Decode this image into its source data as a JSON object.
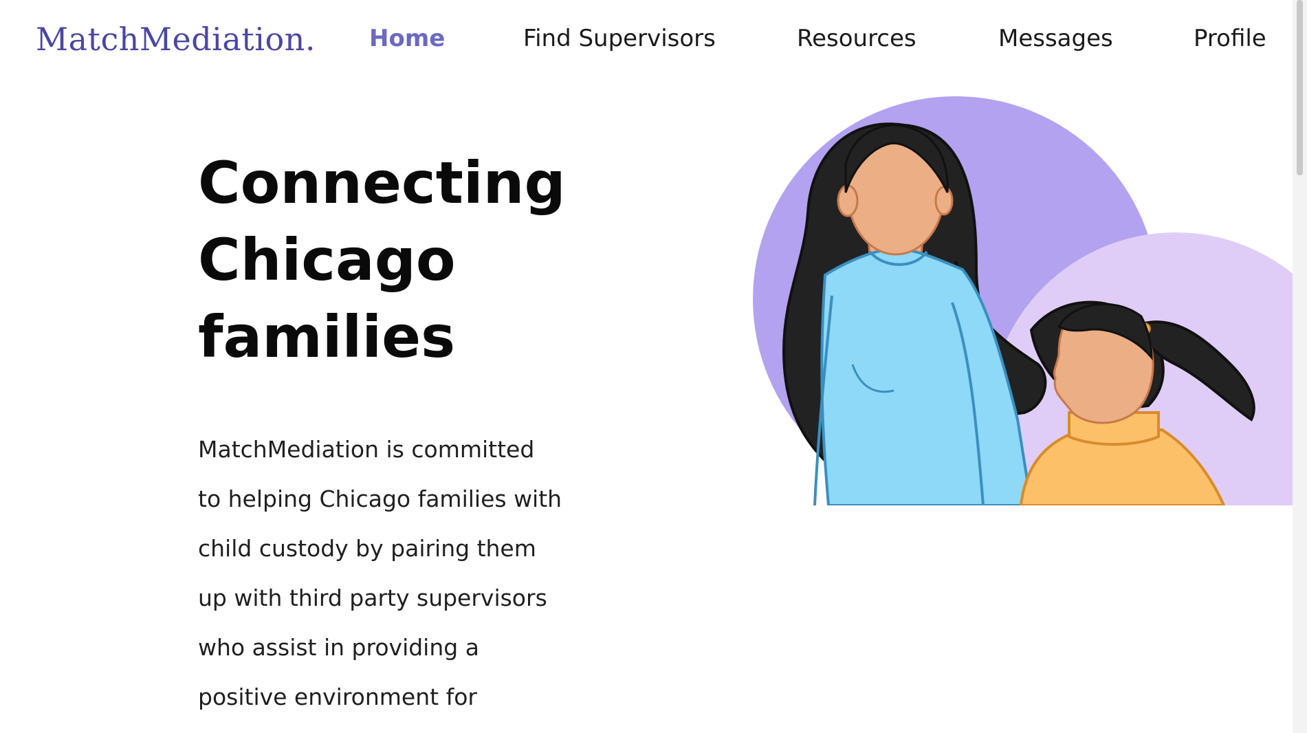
{
  "nav": {
    "logo": "MatchMediation.",
    "links": [
      {
        "label": "Home",
        "active": true
      },
      {
        "label": "Find Supervisors",
        "active": false
      },
      {
        "label": "Resources",
        "active": false
      },
      {
        "label": "Messages",
        "active": false
      },
      {
        "label": "Profile",
        "active": false
      }
    ]
  },
  "hero": {
    "title_lines": [
      "Connecting",
      "Chicago",
      "families"
    ],
    "description_lines": [
      "MatchMediation is committed",
      "to helping Chicago families with",
      "child custody by pairing them",
      "up with third party supervisors",
      "who assist in providing a",
      "positive environment for"
    ]
  },
  "colors": {
    "brand": "#4a47a3",
    "nav_active": "#6b69c1",
    "circle_large": "#b3a2ef",
    "circle_small": "#dfcdf7",
    "mother_shirt": "#8ed8f8",
    "child_shirt": "#fcc068",
    "skin": "#ecae84",
    "hair": "#222222"
  },
  "illustration": {
    "icon": "mother-and-child-illustration"
  }
}
